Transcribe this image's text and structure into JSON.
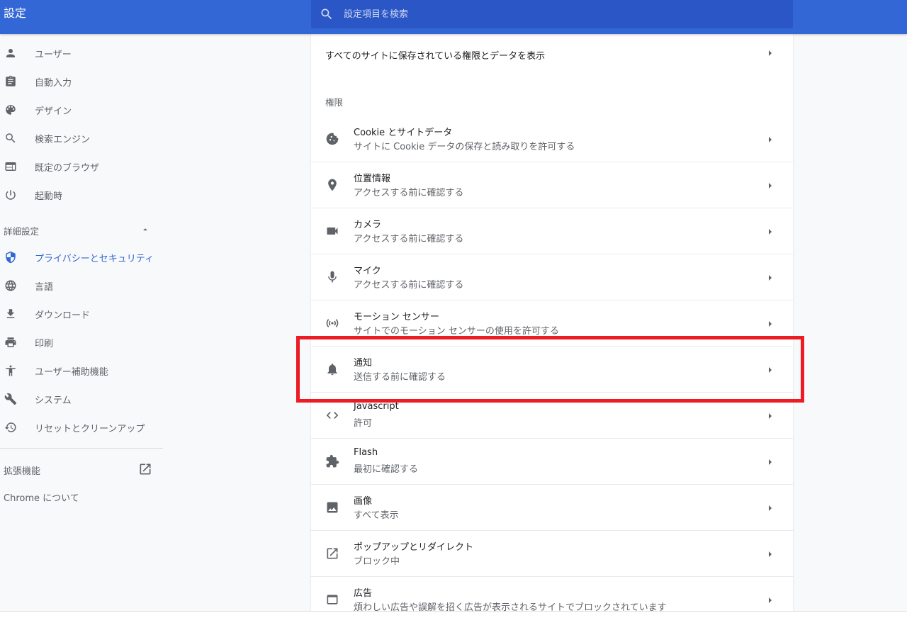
{
  "header": {
    "title": "設定",
    "search_placeholder": "設定項目を検索"
  },
  "sidebar": {
    "items": [
      {
        "label": "ユーザー",
        "icon": "person-icon"
      },
      {
        "label": "自動入力",
        "icon": "clipboard-icon"
      },
      {
        "label": "デザイン",
        "icon": "palette-icon"
      },
      {
        "label": "検索エンジン",
        "icon": "search-icon"
      },
      {
        "label": "既定のブラウザ",
        "icon": "browser-icon"
      },
      {
        "label": "起動時",
        "icon": "power-icon"
      }
    ],
    "advanced_label": "詳細設定",
    "advanced_items": [
      {
        "label": "プライバシーとセキュリティ",
        "icon": "shield-icon",
        "active": true
      },
      {
        "label": "言語",
        "icon": "globe-icon"
      },
      {
        "label": "ダウンロード",
        "icon": "download-icon"
      },
      {
        "label": "印刷",
        "icon": "printer-icon"
      },
      {
        "label": "ユーザー補助機能",
        "icon": "accessibility-icon"
      },
      {
        "label": "システム",
        "icon": "wrench-icon"
      },
      {
        "label": "リセットとクリーンアップ",
        "icon": "restore-icon"
      }
    ],
    "extensions_label": "拡張機能",
    "about_label": "Chrome について"
  },
  "main": {
    "all_sites_label": "すべてのサイトに保存されている権限とデータを表示",
    "permissions_header": "権限",
    "permissions": [
      {
        "title": "Cookie とサイトデータ",
        "subtitle": "サイトに Cookie データの保存と読み取りを許可する",
        "icon": "cookie-icon"
      },
      {
        "title": "位置情報",
        "subtitle": "アクセスする前に確認する",
        "icon": "location-pin-icon"
      },
      {
        "title": "カメラ",
        "subtitle": "アクセスする前に確認する",
        "icon": "camera-icon"
      },
      {
        "title": "マイク",
        "subtitle": "アクセスする前に確認する",
        "icon": "microphone-icon"
      },
      {
        "title": "モーション センサー",
        "subtitle": "サイトでのモーション センサーの使用を許可する",
        "icon": "sensor-icon"
      },
      {
        "title": "通知",
        "subtitle": "送信する前に確認する",
        "icon": "bell-icon"
      },
      {
        "title": "Javascript",
        "subtitle": "許可",
        "icon": "code-icon"
      },
      {
        "title": "Flash",
        "subtitle": "最初に確認する",
        "icon": "puzzle-icon"
      },
      {
        "title": "画像",
        "subtitle": "すべて表示",
        "icon": "image-icon"
      },
      {
        "title": "ポップアップとリダイレクト",
        "subtitle": "ブロック中",
        "icon": "open-in-new-icon"
      },
      {
        "title": "広告",
        "subtitle": "煩わしい広告や誤解を招く広告が表示されるサイトでブロックされています",
        "icon": "ad-window-icon"
      }
    ]
  },
  "colors": {
    "header_blue": "#3367d6",
    "search_blue": "#2a56c6",
    "active_blue": "#3367d6",
    "highlight_red": "#ed1c24"
  }
}
